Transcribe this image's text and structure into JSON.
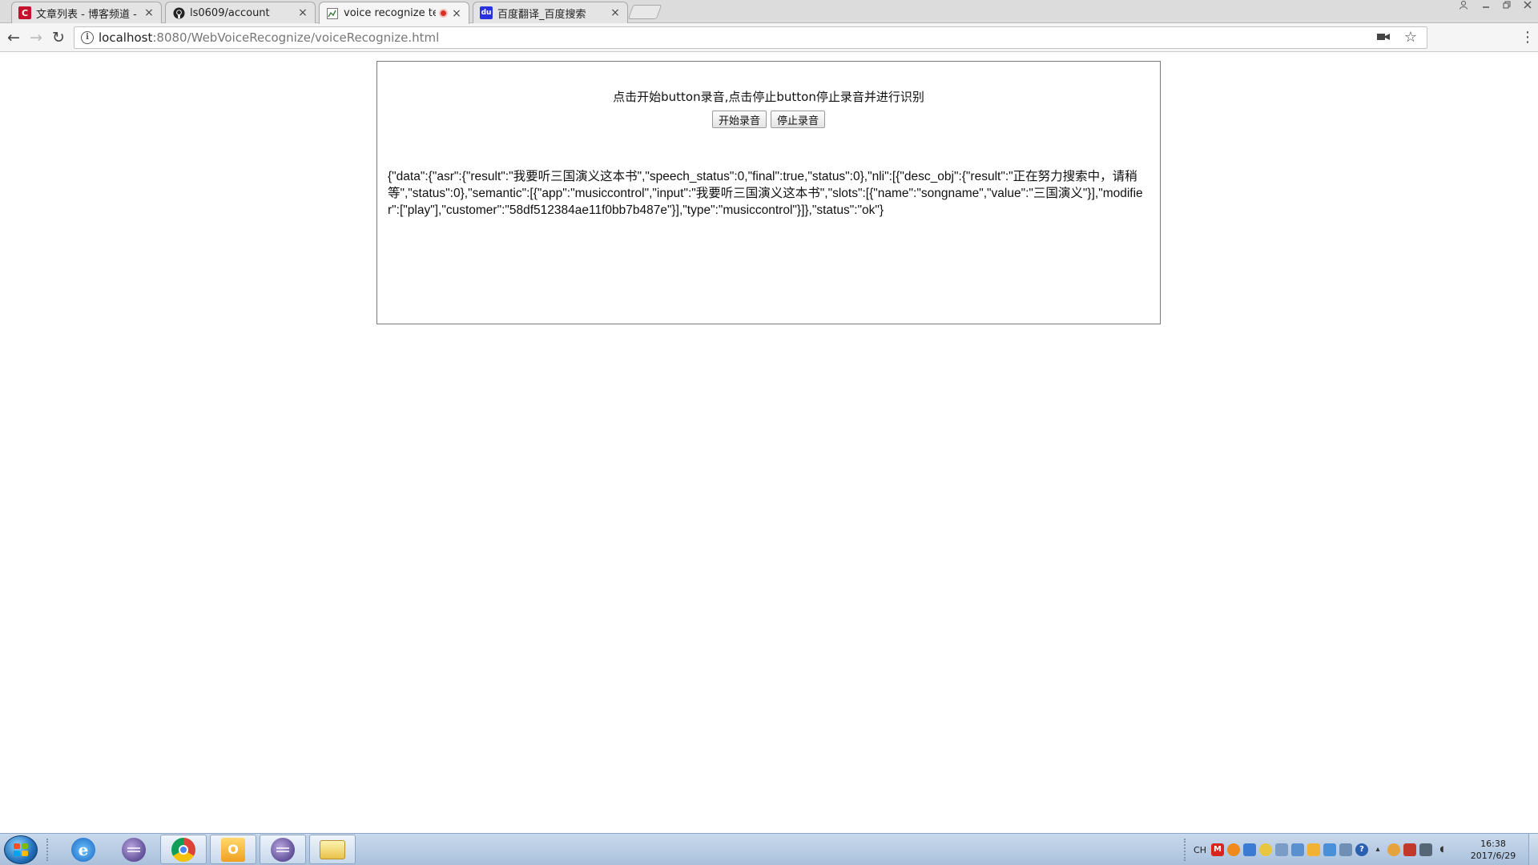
{
  "browser": {
    "tabs": [
      {
        "title": "文章列表 - 博客频道 - C",
        "icon": "csdn-icon"
      },
      {
        "title": "ls0609/account",
        "icon": "github-icon"
      },
      {
        "title": "voice recognize test",
        "icon": "page-icon",
        "active": true,
        "recording": true
      },
      {
        "title": "百度翻译_百度搜索",
        "icon": "baidu-icon"
      }
    ],
    "close_glyph": "×",
    "url_host": "localhost",
    "url_path": ":8080/WebVoiceRecognize/voiceRecognize.html",
    "info_glyph": "i",
    "star_glyph": "☆",
    "menu_glyph": "⋮",
    "back_glyph": "←",
    "forward_glyph": "→",
    "reload_glyph": "↻"
  },
  "page": {
    "instructions": "点击开始button录音,点击停止button停止录音并进行识别",
    "start_button": "开始录音",
    "stop_button": "停止录音",
    "result": "{\"data\":{\"asr\":{\"result\":\"我要听三国演义这本书\",\"speech_status\":0,\"final\":true,\"status\":0},\"nli\":[{\"desc_obj\":{\"result\":\"正在努力搜索中，请稍等\",\"status\":0},\"semantic\":[{\"app\":\"musiccontrol\",\"input\":\"我要听三国演义这本书\",\"slots\":[{\"name\":\"songname\",\"value\":\"三国演义\"}],\"modifier\":[\"play\"],\"customer\":\"58df512384ae11f0bb7b487e\"}],\"type\":\"musiccontrol\"}]},\"status\":\"ok\"}"
  },
  "taskbar": {
    "apps": [
      "ie-icon",
      "eclipse-icon",
      "chrome-icon",
      "outlook-icon",
      "eclipse-icon",
      "explorer-icon"
    ],
    "ime": "CH",
    "time": "16:38",
    "date": "2017/6/29"
  }
}
